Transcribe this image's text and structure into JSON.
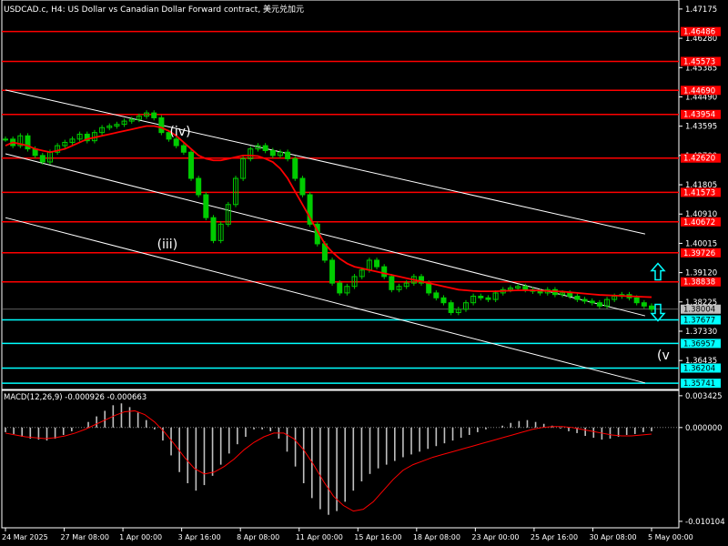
{
  "chart_title": "USDCAD.c, H4:  US Dollar vs Canadian Dollar Forward contract, 美元兑加元",
  "macd_title": "MACD(12,26,9) -0.000926 -0.000663",
  "colors": {
    "background": "#000000",
    "resistance": "#ff0000",
    "support": "#00ffff",
    "candles": "#00cc00",
    "ma": "#ff0000",
    "channel": "#ffffff",
    "macd_hist": "#c0c0c0",
    "macd_signal": "#ff0000",
    "arrows": "#00ffff"
  },
  "wave_labels": [
    {
      "text": "(iii)",
      "date": "3 Apr 04:00",
      "price": 1.3995
    },
    {
      "text": "(iv)",
      "date": "4 Apr 16:00",
      "price": 1.434
    },
    {
      "text": "(v",
      "date": "5 May 08:00",
      "price": 1.3655
    }
  ],
  "arrow_icons": [
    "arrow-up-icon",
    "arrow-down-icon"
  ],
  "chart_data": [
    {
      "type": "candlestick",
      "symbol": "USDCAD.c",
      "timeframe": "H4",
      "ylim": [
        1.3555,
        1.4745
      ],
      "price_ticks": [
        "1.47175",
        "1.46280",
        "1.45385",
        "1.44490",
        "1.43595",
        "1.42700",
        "1.41805",
        "1.40910",
        "1.40015",
        "1.39120",
        "1.38225",
        "1.37330",
        "1.36435"
      ],
      "x_labels": [
        "24 Mar 2025",
        "27 Mar 08:00",
        "1 Apr 00:00",
        "3 Apr 16:00",
        "8 Apr 08:00",
        "11 Apr 00:00",
        "15 Apr 16:00",
        "18 Apr 08:00",
        "23 Apr 00:00",
        "25 Apr 16:00",
        "30 Apr 08:00",
        "5 May 00:00"
      ],
      "current_price": "1.38004",
      "resistance_levels": [
        "1.46486",
        "1.45573",
        "1.44690",
        "1.43954",
        "1.42620",
        "1.41573",
        "1.40672",
        "1.39726",
        "1.38838"
      ],
      "support_levels": [
        "1.37677",
        "1.36957",
        "1.36204",
        "1.35741"
      ],
      "close": [
        1.432,
        1.43,
        1.433,
        1.429,
        1.427,
        1.425,
        1.428,
        1.43,
        1.431,
        1.432,
        1.4335,
        1.4315,
        1.434,
        1.4355,
        1.436,
        1.4365,
        1.4375,
        1.438,
        1.439,
        1.44,
        1.4385,
        1.434,
        1.432,
        1.43,
        1.428,
        1.42,
        1.415,
        1.408,
        1.401,
        1.406,
        1.412,
        1.42,
        1.426,
        1.429,
        1.43,
        1.4285,
        1.427,
        1.428,
        1.426,
        1.42,
        1.415,
        1.406,
        1.4,
        1.395,
        1.388,
        1.385,
        1.387,
        1.39,
        1.392,
        1.395,
        1.393,
        1.39,
        1.386,
        1.387,
        1.388,
        1.39,
        1.388,
        1.385,
        1.3835,
        1.382,
        1.379,
        1.38,
        1.382,
        1.384,
        1.3835,
        1.383,
        1.385,
        1.386,
        1.3865,
        1.387,
        1.386,
        1.3855,
        1.385,
        1.386,
        1.3845,
        1.385,
        1.384,
        1.383,
        1.3825,
        1.382,
        1.381,
        1.383,
        1.384,
        1.3845,
        1.3835,
        1.382,
        1.381,
        1.38
      ],
      "ma_close": [
        1.43,
        1.431,
        1.4305,
        1.43,
        1.429,
        1.4285,
        1.428,
        1.4285,
        1.429,
        1.43,
        1.431,
        1.432,
        1.4325,
        1.433,
        1.4335,
        1.434,
        1.4345,
        1.435,
        1.4355,
        1.436,
        1.436,
        1.4355,
        1.4345,
        1.433,
        1.431,
        1.429,
        1.427,
        1.426,
        1.4255,
        1.4255,
        1.426,
        1.4265,
        1.427,
        1.427,
        1.4268,
        1.426,
        1.425,
        1.423,
        1.42,
        1.416,
        1.412,
        1.408,
        1.404,
        1.4,
        1.3975,
        1.3955,
        1.394,
        1.393,
        1.3925,
        1.392,
        1.3915,
        1.391,
        1.3905,
        1.39,
        1.3895,
        1.389,
        1.3885,
        1.388,
        1.3875,
        1.387,
        1.3865,
        1.386,
        1.3858,
        1.3856,
        1.3855,
        1.3855,
        1.3855,
        1.3856,
        1.3857,
        1.3858,
        1.3858,
        1.3858,
        1.3857,
        1.3856,
        1.3855,
        1.3854,
        1.3852,
        1.385,
        1.3848,
        1.3846,
        1.3844,
        1.3843,
        1.3842,
        1.3841,
        1.384,
        1.3839,
        1.3838,
        1.3837
      ],
      "channel_lines": [
        {
          "from": [
            "24 Mar 00:00",
            1.447
          ],
          "to": [
            "5 May 00:00",
            1.403
          ]
        },
        {
          "from": [
            "24 Mar 00:00",
            1.4275
          ],
          "to": [
            "5 May 00:00",
            1.378
          ]
        },
        {
          "from": [
            "24 Mar 00:00",
            1.408
          ],
          "to": [
            "5 May 00:00",
            1.3575
          ]
        }
      ]
    },
    {
      "type": "bar",
      "name": "MACD(12,26,9)",
      "ylim": [
        -0.0108,
        0.004
      ],
      "y_ticks": [
        "0.003425",
        "0.000000",
        "-0.010104"
      ],
      "histogram": [
        -0.0005,
        -0.0007,
        -0.001,
        -0.0012,
        -0.0013,
        -0.0014,
        -0.0012,
        -0.0008,
        -0.0004,
        0.0,
        0.0006,
        0.0012,
        0.0018,
        0.0024,
        0.0026,
        0.0022,
        0.0016,
        0.0008,
        -0.0002,
        -0.0014,
        -0.003,
        -0.0048,
        -0.006,
        -0.0068,
        -0.0062,
        -0.0052,
        -0.004,
        -0.0028,
        -0.0018,
        -0.001,
        -0.0002,
        -0.0002,
        -0.0004,
        -0.0012,
        -0.0026,
        -0.0042,
        -0.006,
        -0.0076,
        -0.0088,
        -0.0094,
        -0.009,
        -0.008,
        -0.0068,
        -0.0058,
        -0.005,
        -0.0044,
        -0.004,
        -0.0036,
        -0.0032,
        -0.0029,
        -0.0026,
        -0.0023,
        -0.002,
        -0.0017,
        -0.0014,
        -0.0011,
        -0.0008,
        -0.0005,
        -0.0002,
        0.0,
        0.0002,
        0.0005,
        0.0007,
        0.0008,
        0.0006,
        0.0004,
        0.0002,
        -0.0001,
        -0.0004,
        -0.0006,
        -0.0009,
        -0.0011,
        -0.0013,
        -0.0012,
        -0.001,
        -0.0008,
        -0.0007,
        -0.0005,
        -0.0004
      ],
      "signal": [
        -0.0006,
        -0.0008,
        -0.001,
        -0.0011,
        -0.0012,
        -0.0011,
        -0.0009,
        -0.0006,
        -0.0002,
        0.0003,
        0.0008,
        0.0013,
        0.0017,
        0.0018,
        0.0014,
        0.0006,
        -0.0005,
        -0.0018,
        -0.0032,
        -0.0044,
        -0.005,
        -0.0048,
        -0.0042,
        -0.0034,
        -0.0024,
        -0.0016,
        -0.001,
        -0.0006,
        -0.0006,
        -0.0012,
        -0.0024,
        -0.004,
        -0.0058,
        -0.0074,
        -0.0084,
        -0.009,
        -0.0088,
        -0.008,
        -0.0068,
        -0.0056,
        -0.0046,
        -0.004,
        -0.0036,
        -0.0032,
        -0.0029,
        -0.0026,
        -0.0023,
        -0.002,
        -0.0017,
        -0.0014,
        -0.0011,
        -0.0008,
        -0.0005,
        -0.0002,
        0.0,
        0.0001,
        0.0001,
        0.0,
        -0.0002,
        -0.0004,
        -0.0006,
        -0.0008,
        -0.0009,
        -0.0009,
        -0.0008,
        -0.0007
      ]
    }
  ]
}
